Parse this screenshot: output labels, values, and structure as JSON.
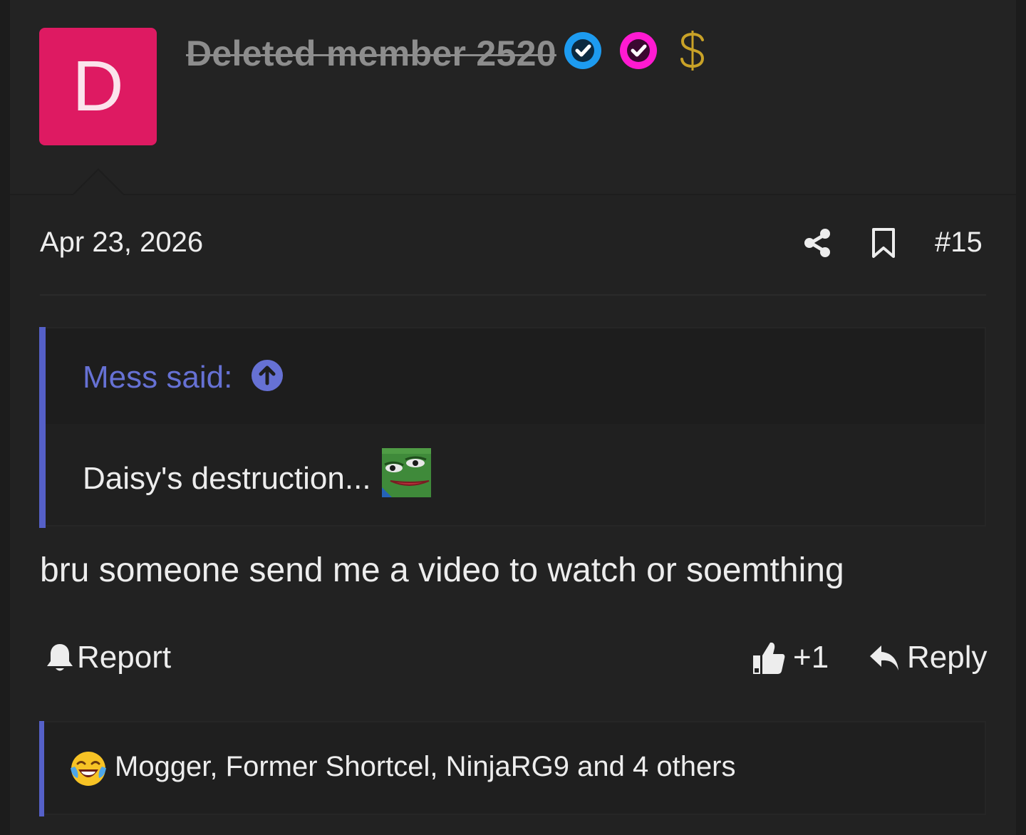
{
  "user": {
    "avatar_letter": "D",
    "avatar_color": "#de1a62",
    "username": "Deleted member 2520",
    "badges": [
      {
        "icon": "verified-check-blue-icon",
        "color": "#1d9bf0"
      },
      {
        "icon": "verified-check-magenta-icon",
        "color": "#ff1ad1"
      },
      {
        "icon": "dollar-sign-icon",
        "color": "#c9a227"
      }
    ]
  },
  "post": {
    "date": "Apr 23, 2026",
    "number": "#15",
    "icons": {
      "share": "share-icon",
      "bookmark": "bookmark-icon"
    },
    "quote": {
      "author_label": "Mess said:",
      "text": "Daisy's destruction...",
      "accent_color": "#5560c8"
    },
    "body": "bru someone send me a video to watch or soemthing"
  },
  "actions": {
    "report_label": "Report",
    "like_label": "+1",
    "reply_label": "Reply"
  },
  "reactions": {
    "emoji": "joy-tears-emoji-icon",
    "text": "Mogger, Former Shortcel, NinjaRG9 and 4 others"
  }
}
